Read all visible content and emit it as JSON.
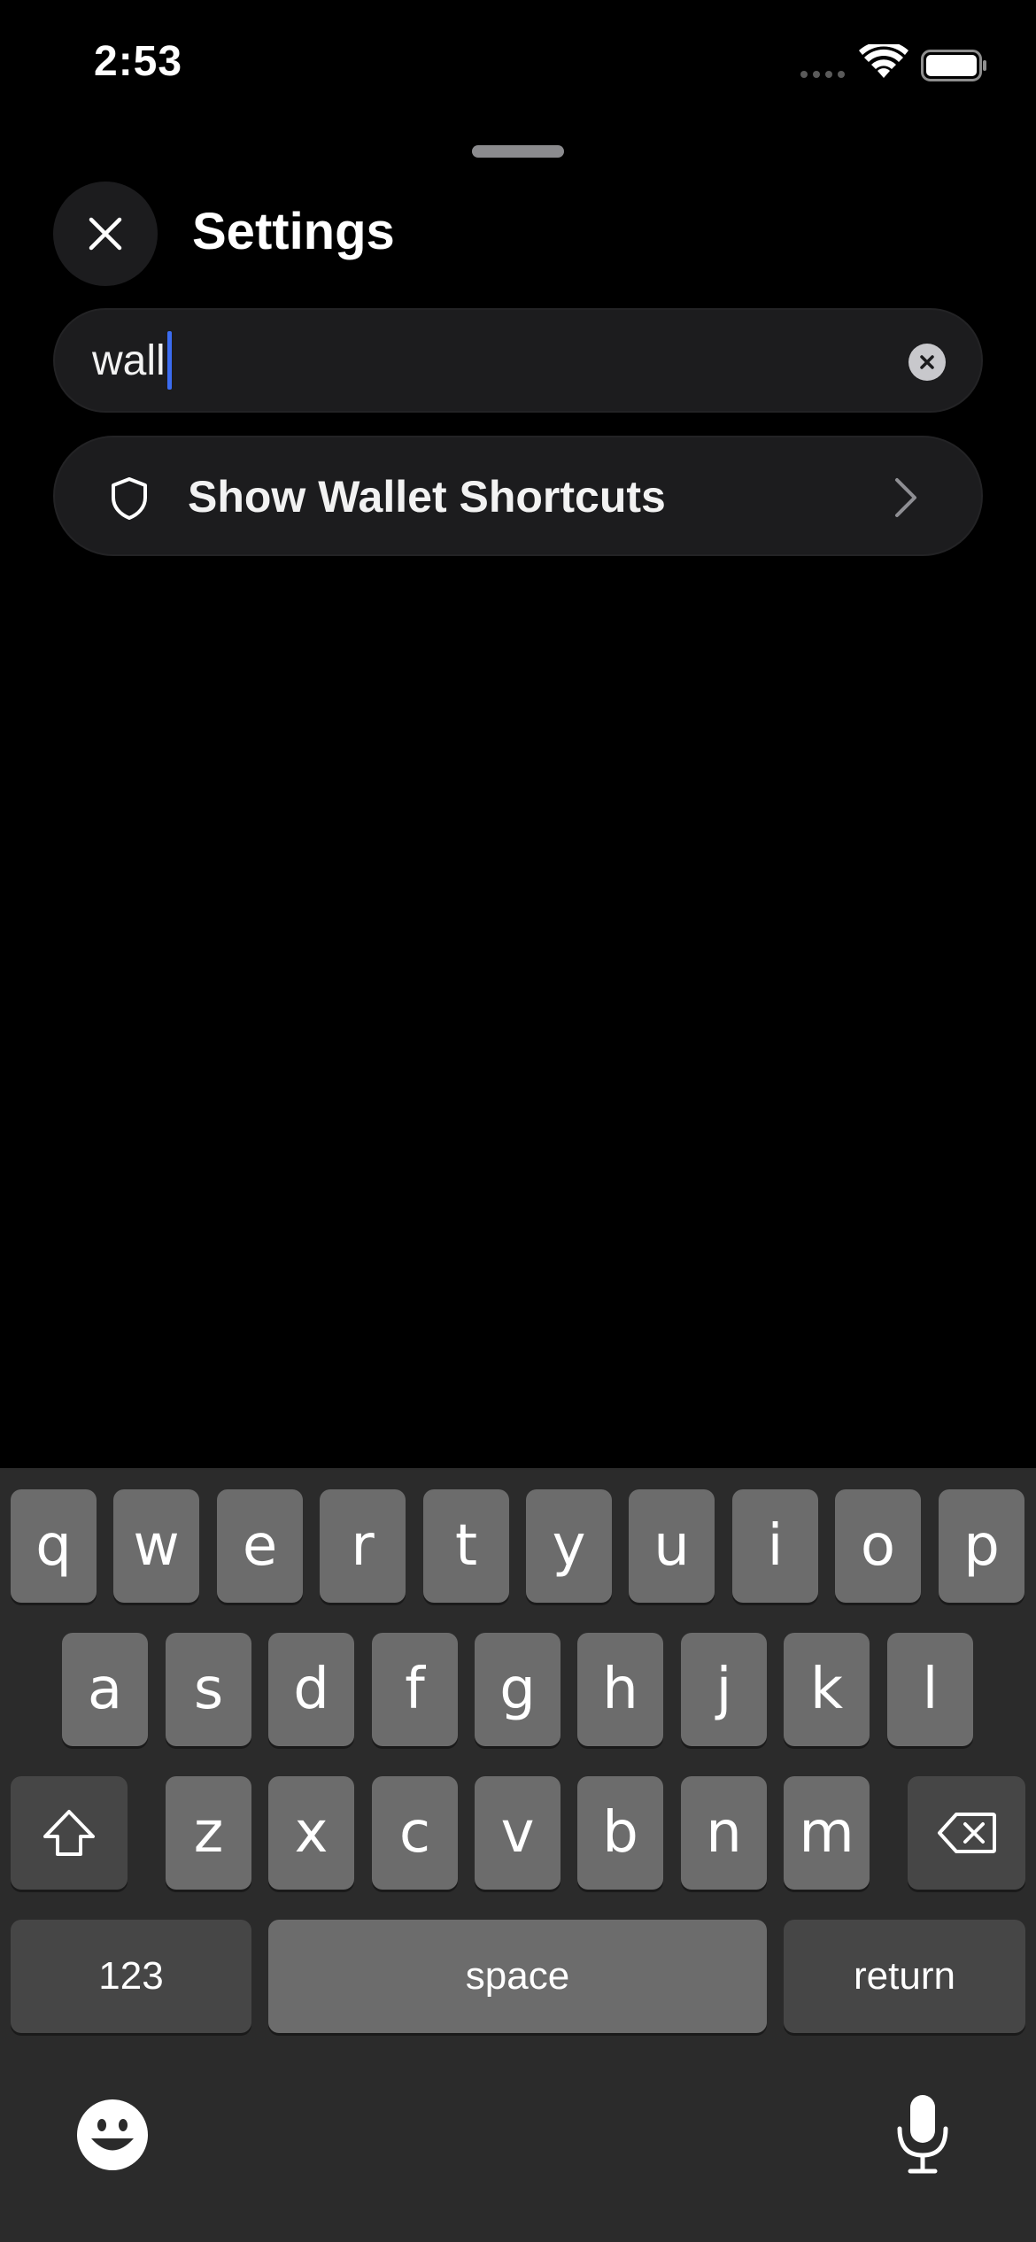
{
  "status_bar": {
    "time": "2:53",
    "wifi_icon": "wifi-icon",
    "battery_icon": "battery-icon"
  },
  "header": {
    "title": "Settings",
    "close_icon": "close-icon"
  },
  "search": {
    "value": "wall",
    "clear_icon": "clear-circle-icon"
  },
  "results": [
    {
      "icon": "shield-icon",
      "label": "Show Wallet Shortcuts",
      "trailing_icon": "chevron-right-icon"
    }
  ],
  "keyboard": {
    "row1": [
      "q",
      "w",
      "e",
      "r",
      "t",
      "y",
      "u",
      "i",
      "o",
      "p"
    ],
    "row2": [
      "a",
      "s",
      "d",
      "f",
      "g",
      "h",
      "j",
      "k",
      "l"
    ],
    "row3": [
      "z",
      "x",
      "c",
      "v",
      "b",
      "n",
      "m"
    ],
    "numbers_label": "123",
    "space_label": "space",
    "return_label": "return",
    "shift_icon": "shift-icon",
    "delete_icon": "delete-backspace-icon",
    "emoji_icon": "emoji-icon",
    "mic_icon": "microphone-icon"
  },
  "colors": {
    "background": "#000000",
    "surface": "#1c1c1e",
    "caret": "#3b6cf0",
    "keyboard_bg": "#2b2b2b",
    "key_light": "#6c6c6c",
    "key_dark": "#464646"
  }
}
